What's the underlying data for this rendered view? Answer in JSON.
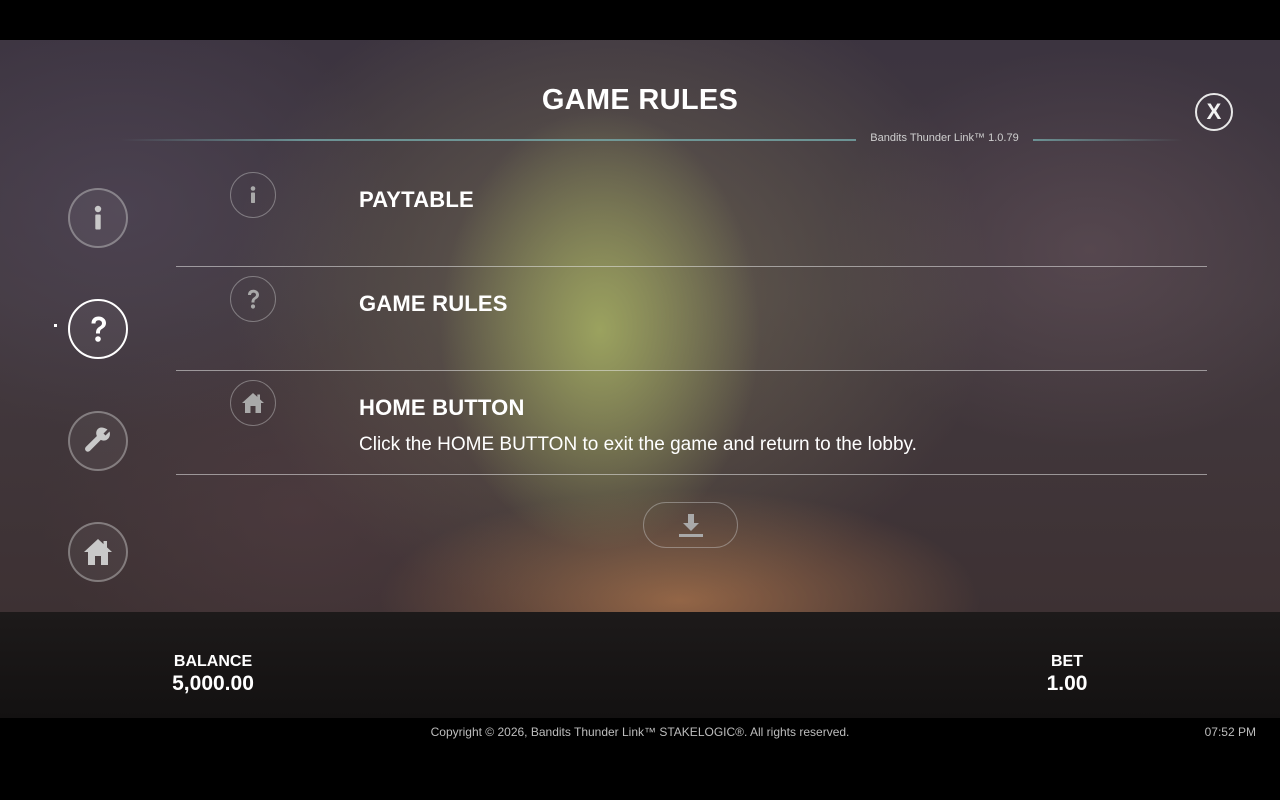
{
  "header": {
    "title": "GAME RULES",
    "version": "Bandits Thunder Link™ 1.0.79",
    "close_label": "X"
  },
  "sidebar": {
    "items": [
      {
        "name": "info",
        "icon": "info-icon",
        "active": false
      },
      {
        "name": "game-rules",
        "icon": "question-icon",
        "active": true
      },
      {
        "name": "settings",
        "icon": "wrench-icon",
        "active": false
      },
      {
        "name": "home",
        "icon": "home-icon",
        "active": false
      }
    ]
  },
  "rules": [
    {
      "icon": "info-icon",
      "title": "PAYTABLE",
      "description": ""
    },
    {
      "icon": "question-icon",
      "title": "GAME RULES",
      "description": ""
    },
    {
      "icon": "home-icon",
      "title": "HOME BUTTON",
      "description": "Click the HOME BUTTON to exit the game and return to the lobby."
    }
  ],
  "download": {
    "icon": "download-icon"
  },
  "stats": {
    "balance_label": "BALANCE",
    "balance_value": "5,000.00",
    "bet_label": "BET",
    "bet_value": "1.00"
  },
  "footer": {
    "copyright": "Copyright © 2026, Bandits Thunder Link™ STAKELOGIC®. All rights reserved.",
    "time": "07:52 PM"
  },
  "colors": {
    "accent_line": "#78afaf",
    "panel_bg": "#1d1a1a",
    "text": "#ffffff"
  }
}
